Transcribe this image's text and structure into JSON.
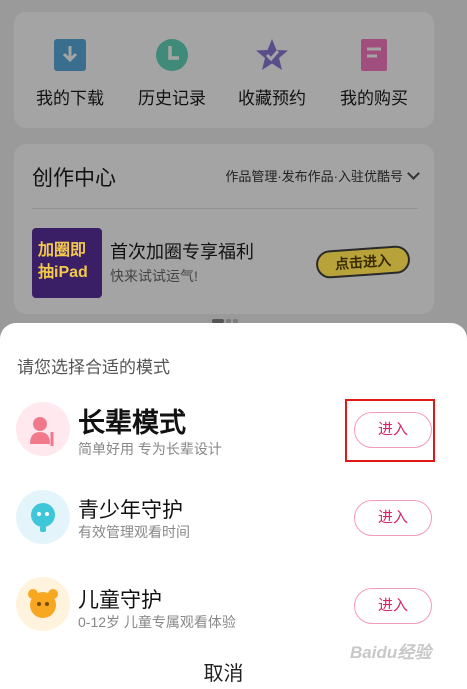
{
  "quick_actions": [
    {
      "label": "我的下载",
      "icon": "download-icon",
      "color": "#3a6e8e"
    },
    {
      "label": "历史记录",
      "icon": "clock-icon",
      "color": "#3f8a78"
    },
    {
      "label": "收藏预约",
      "icon": "star-icon",
      "color": "#5a4e8a"
    },
    {
      "label": "我的购买",
      "icon": "receipt-icon",
      "color": "#a04e7e"
    }
  ],
  "creator_center": {
    "title": "创作中心",
    "links": "作品管理·发布作品·入驻优酷号",
    "promo": {
      "image_text": "加圈即抽iPad",
      "title": "首次加圈专享福利",
      "subtitle": "快来试试运气!",
      "button": "点击进入"
    }
  },
  "mode_sheet": {
    "title": "请您选择合适的模式",
    "modes": [
      {
        "name": "长辈模式",
        "desc": "简单好用 专为长辈设计",
        "button": "进入",
        "icon": "elder-icon",
        "color": "#ffe8ee"
      },
      {
        "name": "青少年守护",
        "desc": "有效管理观看时间",
        "button": "进入",
        "icon": "teen-icon",
        "color": "#e3f5fb"
      },
      {
        "name": "儿童守护",
        "desc": "0-12岁 儿童专属观看体验",
        "button": "进入",
        "icon": "child-icon",
        "color": "#fff3dd"
      }
    ],
    "cancel": "取消"
  },
  "watermark": "Baidu经验",
  "colors": {
    "accent": "#d4236a",
    "highlight": "#e01818"
  }
}
